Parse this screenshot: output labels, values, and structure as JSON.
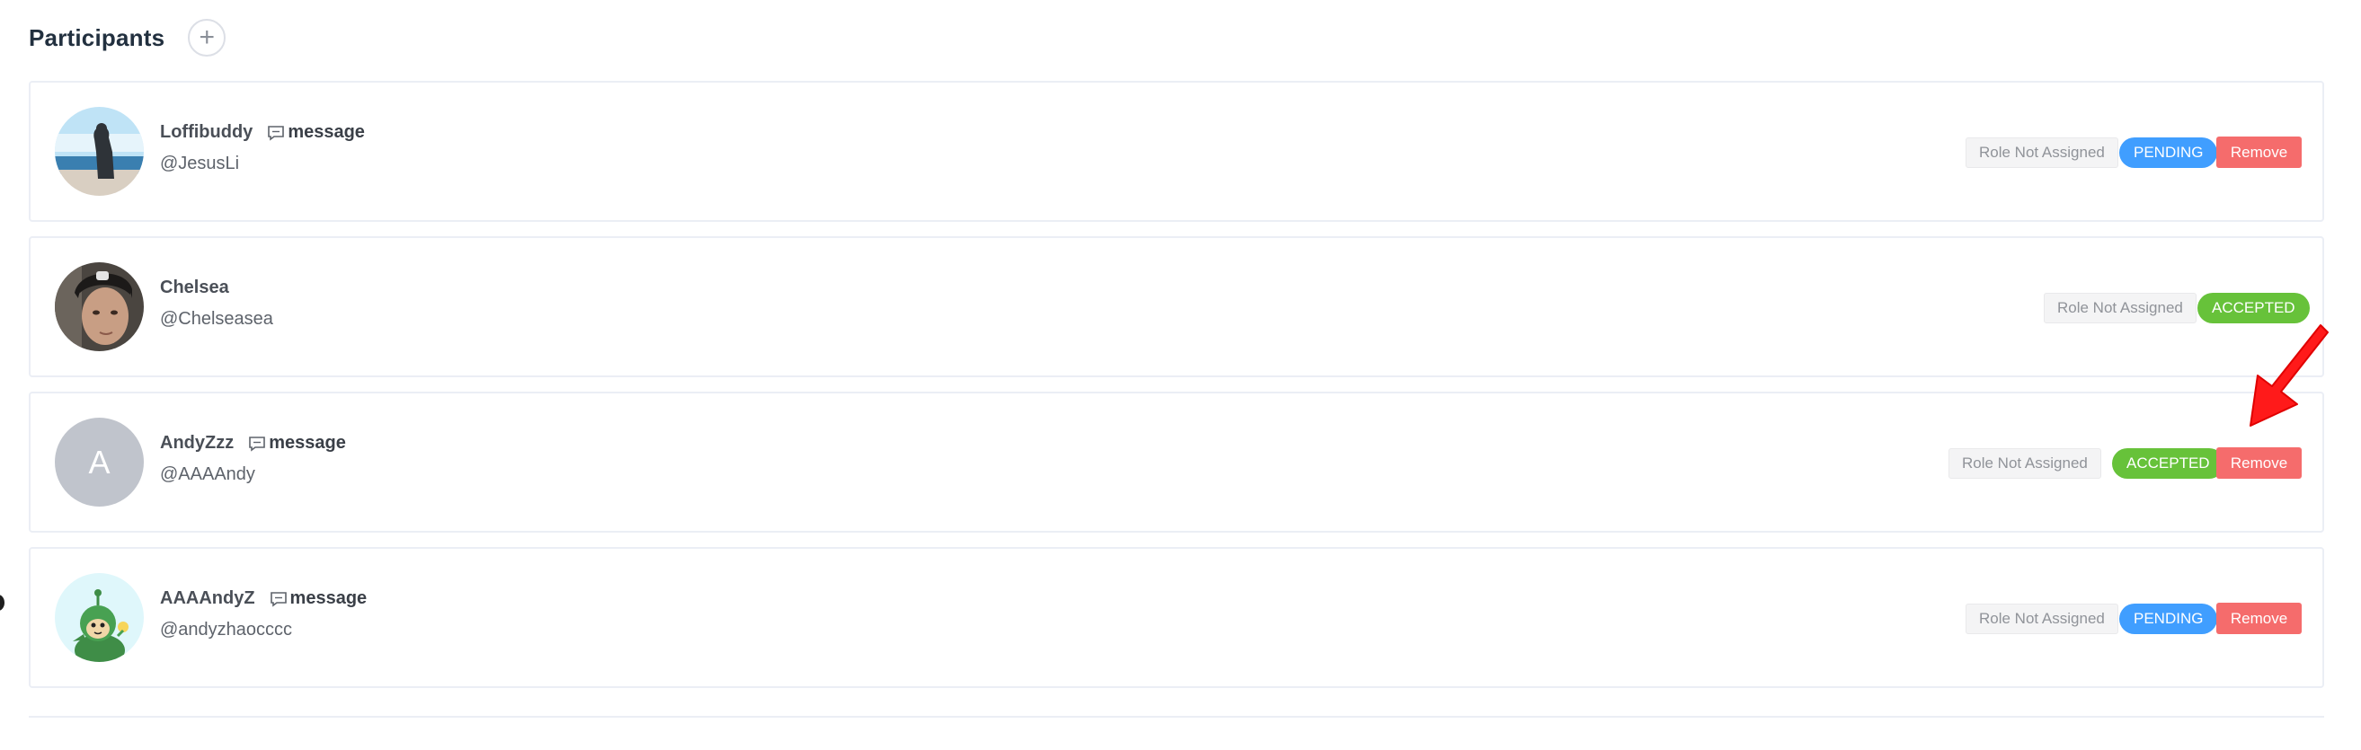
{
  "header": {
    "title": "Participants",
    "add_icon": "plus-icon"
  },
  "participants": [
    {
      "name": "Loffibuddy",
      "handle": "@JesusLi",
      "message_label": "message",
      "has_message": true,
      "avatar": "photo",
      "role": "Role Not Assigned",
      "status": "PENDING",
      "remove_label": "Remove",
      "has_remove": true
    },
    {
      "name": "Chelsea",
      "handle": "@Chelseasea",
      "message_label": "",
      "has_message": false,
      "avatar": "photo",
      "role": "Role Not Assigned",
      "status": "ACCEPTED",
      "remove_label": "",
      "has_remove": false
    },
    {
      "name": "AndyZzz",
      "handle": "@AAAAndy",
      "message_label": "message",
      "has_message": true,
      "avatar_letter": "A",
      "role": "Role Not Assigned",
      "status": "ACCEPTED",
      "remove_label": "Remove",
      "has_remove": true
    },
    {
      "name": "AAAAndyZ",
      "handle": "@andyzhaocccc",
      "message_label": "message",
      "has_message": true,
      "avatar": "illustration",
      "role": "Role Not Assigned",
      "status": "PENDING",
      "remove_label": "Remove",
      "has_remove": true
    }
  ],
  "colors": {
    "pending": "#409eff",
    "accepted": "#67c23a",
    "remove": "#f56c6c",
    "annotation_arrow": "#ff1a1a"
  }
}
